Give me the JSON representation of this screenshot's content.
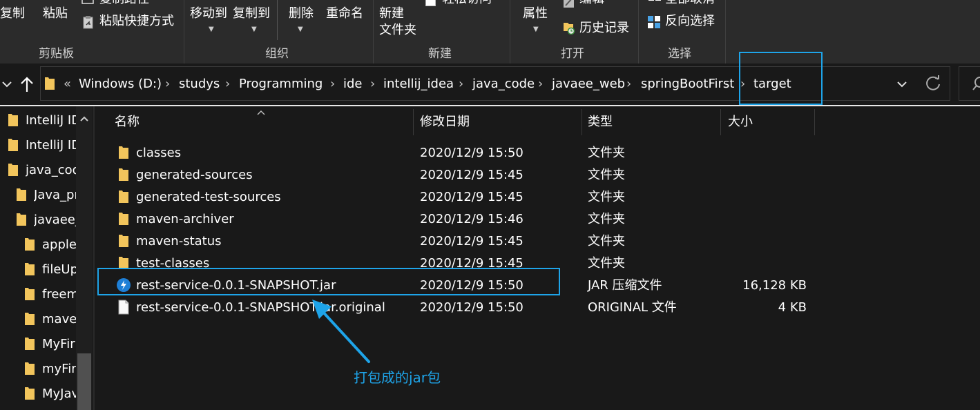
{
  "ribbon": {
    "clipboard": {
      "copy": "复制",
      "paste": "粘贴",
      "copy_path": "复制路径",
      "paste_shortcut": "粘贴快捷方式",
      "title": "剪贴板"
    },
    "organize": {
      "move_to": "移动到",
      "copy_to": "复制到",
      "delete": "删除",
      "rename": "重命名",
      "title": "组织"
    },
    "new": {
      "new_folder": "新建\n文件夹",
      "easy_access": "轻松访问",
      "title": "新建"
    },
    "open": {
      "properties": "属性",
      "edit": "编辑",
      "history": "历史记录",
      "title": "打开"
    },
    "select": {
      "select_none": "全部取消",
      "invert_selection": "反向选择",
      "title": "选择"
    }
  },
  "address": {
    "overflow": "«",
    "crumbs": [
      "Windows (D:)",
      "studys",
      "Programming",
      "ide",
      "intellij_idea",
      "java_code",
      "javaee_web",
      "springBootFirst",
      "target"
    ],
    "separator": "›"
  },
  "nav_pane": {
    "items": [
      "IntelliJ ID",
      "IntelliJ ID",
      "java_cod",
      "Java_pr",
      "javaee_",
      "apple",
      "fileUp",
      "freem",
      "mave",
      "MyFir",
      "myFir",
      "MyJav"
    ]
  },
  "columns": {
    "name": "名称",
    "modified": "修改日期",
    "type": "类型",
    "size": "大小"
  },
  "files": [
    {
      "name": "classes",
      "date": "2020/12/9 15:50",
      "type": "文件夹",
      "size": "",
      "icon": "folder-icon"
    },
    {
      "name": "generated-sources",
      "date": "2020/12/9 15:45",
      "type": "文件夹",
      "size": "",
      "icon": "folder-icon"
    },
    {
      "name": "generated-test-sources",
      "date": "2020/12/9 15:45",
      "type": "文件夹",
      "size": "",
      "icon": "folder-icon"
    },
    {
      "name": "maven-archiver",
      "date": "2020/12/9 15:46",
      "type": "文件夹",
      "size": "",
      "icon": "folder-icon"
    },
    {
      "name": "maven-status",
      "date": "2020/12/9 15:45",
      "type": "文件夹",
      "size": "",
      "icon": "folder-icon"
    },
    {
      "name": "test-classes",
      "date": "2020/12/9 15:45",
      "type": "文件夹",
      "size": "",
      "icon": "folder-icon"
    },
    {
      "name": "rest-service-0.0.1-SNAPSHOT.jar",
      "date": "2020/12/9 15:50",
      "type": "JAR 压缩文件",
      "size": "16,128 KB",
      "icon": "jar-icon"
    },
    {
      "name": "rest-service-0.0.1-SNAPSHOT.jar.original",
      "date": "2020/12/9 15:50",
      "type": "ORIGINAL 文件",
      "size": "4 KB",
      "icon": "file-icon"
    }
  ],
  "annotation": {
    "callout": "打包成的jar包",
    "color": "#1ea4e9"
  },
  "colors": {
    "background": "#191919",
    "ribbon": "#2b2b2b",
    "folder": "#f2c55c",
    "annotation": "#1ea4e9"
  }
}
